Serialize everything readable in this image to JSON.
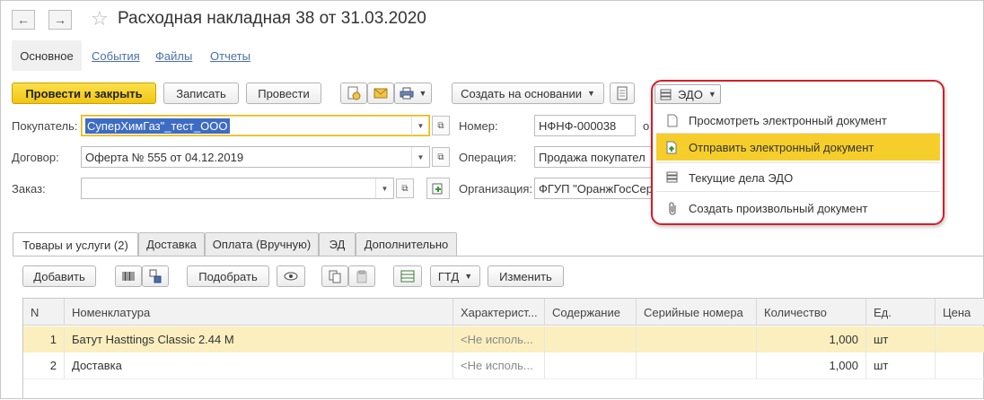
{
  "window": {
    "title": "Расходная накладная 38 от 31.03.2020"
  },
  "top_tabs": {
    "main": "Основное",
    "events": "События",
    "files": "Файлы",
    "reports": "Отчеты"
  },
  "toolbar": {
    "post_close": "Провести и закрыть",
    "save": "Записать",
    "post": "Провести",
    "create_based": "Создать на основании",
    "edo": "ЭДО"
  },
  "form": {
    "buyer_label": "Покупатель:",
    "buyer_value": "СуперХимГаз\"_тест_ООО",
    "contract_label": "Договор:",
    "contract_value": "Оферта № 555 от 04.12.2019",
    "order_label": "Заказ:",
    "order_value": "",
    "number_label": "Номер:",
    "number_value": "НФНФ-000038",
    "operation_label": "Операция:",
    "operation_value": "Продажа покупател",
    "org_label": "Организация:",
    "org_value": "ФГУП \"ОранжГосСер",
    "truncated_label_fragment": "о"
  },
  "edo_menu": {
    "items": [
      {
        "label": "Просмотреть электронный документ",
        "icon": "document-icon"
      },
      {
        "label": "Отправить электронный документ",
        "icon": "send-document-icon"
      },
      {
        "label": "Текущие дела ЭДО",
        "icon": "edo-tasks-icon"
      },
      {
        "label": "Создать произвольный документ",
        "icon": "paperclip-icon"
      }
    ]
  },
  "tabs": [
    "Товары и услуги (2)",
    "Доставка",
    "Оплата (Вручную)",
    "ЭД",
    "Дополнительно"
  ],
  "table_toolbar": {
    "add": "Добавить",
    "pick": "Подобрать",
    "gtd": "ГТД",
    "change": "Изменить"
  },
  "table": {
    "columns": [
      "N",
      "Номенклатура",
      "Характерист...",
      "Содержание",
      "Серийные номера",
      "Количество",
      "Ед.",
      "Цена"
    ],
    "rows": [
      {
        "n": "1",
        "name": "Батут Hasttings Classic 2.44 M",
        "char": "<Не исполь...",
        "content": "",
        "serial": "",
        "qty": "1,000",
        "unit": "шт",
        "price": ""
      },
      {
        "n": "2",
        "name": "Доставка",
        "char": "<Не исполь...",
        "content": "",
        "serial": "",
        "qty": "1,000",
        "unit": "шт",
        "price": ""
      }
    ]
  },
  "colors": {
    "accent_yellow": "#f6ce2b",
    "highlight_border": "#d21f2a",
    "link": "#4d6fa7",
    "selected_row": "#fbefc0"
  }
}
